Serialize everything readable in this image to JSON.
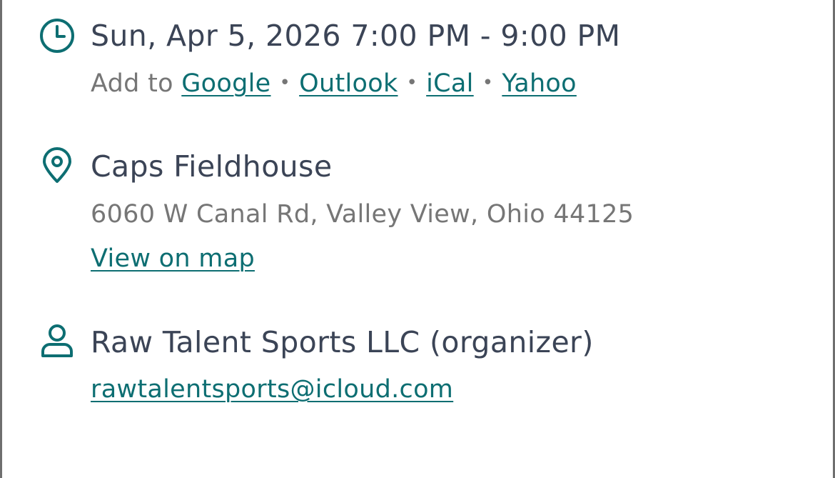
{
  "datetime": {
    "icon": "clock-icon",
    "text": "Sun, Apr 5, 2026 7:00 PM - 9:00 PM",
    "add_to_label": "Add to",
    "calendar_links": [
      "Google",
      "Outlook",
      "iCal",
      "Yahoo"
    ],
    "separator": "•"
  },
  "location": {
    "icon": "map-pin-icon",
    "name": "Caps Fieldhouse",
    "address": "6060 W Canal Rd, Valley View, Ohio 44125",
    "map_link": "View on map"
  },
  "organizer": {
    "icon": "person-icon",
    "name": "Raw Talent Sports LLC (organizer)",
    "email": "rawtalentsports@icloud.com"
  },
  "colors": {
    "accent": "#0d6e72",
    "primary_text": "#3b4456",
    "secondary_text": "#767676",
    "border": "#6f6f6f"
  }
}
